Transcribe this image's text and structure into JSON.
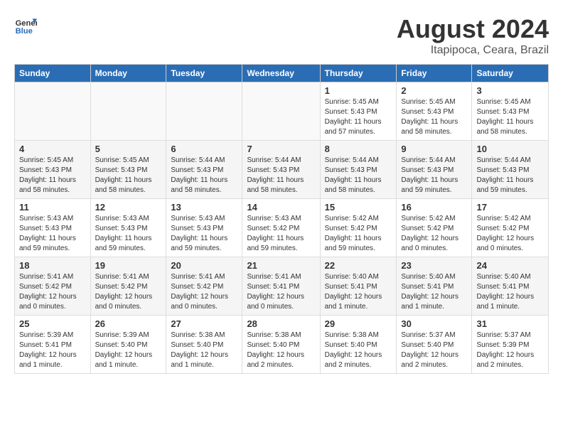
{
  "header": {
    "logo_general": "General",
    "logo_blue": "Blue",
    "title": "August 2024",
    "subtitle": "Itapipoca, Ceara, Brazil"
  },
  "days_of_week": [
    "Sunday",
    "Monday",
    "Tuesday",
    "Wednesday",
    "Thursday",
    "Friday",
    "Saturday"
  ],
  "weeks": [
    [
      {
        "num": "",
        "info": ""
      },
      {
        "num": "",
        "info": ""
      },
      {
        "num": "",
        "info": ""
      },
      {
        "num": "",
        "info": ""
      },
      {
        "num": "1",
        "info": "Sunrise: 5:45 AM\nSunset: 5:43 PM\nDaylight: 11 hours\nand 57 minutes."
      },
      {
        "num": "2",
        "info": "Sunrise: 5:45 AM\nSunset: 5:43 PM\nDaylight: 11 hours\nand 58 minutes."
      },
      {
        "num": "3",
        "info": "Sunrise: 5:45 AM\nSunset: 5:43 PM\nDaylight: 11 hours\nand 58 minutes."
      }
    ],
    [
      {
        "num": "4",
        "info": "Sunrise: 5:45 AM\nSunset: 5:43 PM\nDaylight: 11 hours\nand 58 minutes."
      },
      {
        "num": "5",
        "info": "Sunrise: 5:45 AM\nSunset: 5:43 PM\nDaylight: 11 hours\nand 58 minutes."
      },
      {
        "num": "6",
        "info": "Sunrise: 5:44 AM\nSunset: 5:43 PM\nDaylight: 11 hours\nand 58 minutes."
      },
      {
        "num": "7",
        "info": "Sunrise: 5:44 AM\nSunset: 5:43 PM\nDaylight: 11 hours\nand 58 minutes."
      },
      {
        "num": "8",
        "info": "Sunrise: 5:44 AM\nSunset: 5:43 PM\nDaylight: 11 hours\nand 58 minutes."
      },
      {
        "num": "9",
        "info": "Sunrise: 5:44 AM\nSunset: 5:43 PM\nDaylight: 11 hours\nand 59 minutes."
      },
      {
        "num": "10",
        "info": "Sunrise: 5:44 AM\nSunset: 5:43 PM\nDaylight: 11 hours\nand 59 minutes."
      }
    ],
    [
      {
        "num": "11",
        "info": "Sunrise: 5:43 AM\nSunset: 5:43 PM\nDaylight: 11 hours\nand 59 minutes."
      },
      {
        "num": "12",
        "info": "Sunrise: 5:43 AM\nSunset: 5:43 PM\nDaylight: 11 hours\nand 59 minutes."
      },
      {
        "num": "13",
        "info": "Sunrise: 5:43 AM\nSunset: 5:43 PM\nDaylight: 11 hours\nand 59 minutes."
      },
      {
        "num": "14",
        "info": "Sunrise: 5:43 AM\nSunset: 5:42 PM\nDaylight: 11 hours\nand 59 minutes."
      },
      {
        "num": "15",
        "info": "Sunrise: 5:42 AM\nSunset: 5:42 PM\nDaylight: 11 hours\nand 59 minutes."
      },
      {
        "num": "16",
        "info": "Sunrise: 5:42 AM\nSunset: 5:42 PM\nDaylight: 12 hours\nand 0 minutes."
      },
      {
        "num": "17",
        "info": "Sunrise: 5:42 AM\nSunset: 5:42 PM\nDaylight: 12 hours\nand 0 minutes."
      }
    ],
    [
      {
        "num": "18",
        "info": "Sunrise: 5:41 AM\nSunset: 5:42 PM\nDaylight: 12 hours\nand 0 minutes."
      },
      {
        "num": "19",
        "info": "Sunrise: 5:41 AM\nSunset: 5:42 PM\nDaylight: 12 hours\nand 0 minutes."
      },
      {
        "num": "20",
        "info": "Sunrise: 5:41 AM\nSunset: 5:42 PM\nDaylight: 12 hours\nand 0 minutes."
      },
      {
        "num": "21",
        "info": "Sunrise: 5:41 AM\nSunset: 5:41 PM\nDaylight: 12 hours\nand 0 minutes."
      },
      {
        "num": "22",
        "info": "Sunrise: 5:40 AM\nSunset: 5:41 PM\nDaylight: 12 hours\nand 1 minute."
      },
      {
        "num": "23",
        "info": "Sunrise: 5:40 AM\nSunset: 5:41 PM\nDaylight: 12 hours\nand 1 minute."
      },
      {
        "num": "24",
        "info": "Sunrise: 5:40 AM\nSunset: 5:41 PM\nDaylight: 12 hours\nand 1 minute."
      }
    ],
    [
      {
        "num": "25",
        "info": "Sunrise: 5:39 AM\nSunset: 5:41 PM\nDaylight: 12 hours\nand 1 minute."
      },
      {
        "num": "26",
        "info": "Sunrise: 5:39 AM\nSunset: 5:40 PM\nDaylight: 12 hours\nand 1 minute."
      },
      {
        "num": "27",
        "info": "Sunrise: 5:38 AM\nSunset: 5:40 PM\nDaylight: 12 hours\nand 1 minute."
      },
      {
        "num": "28",
        "info": "Sunrise: 5:38 AM\nSunset: 5:40 PM\nDaylight: 12 hours\nand 2 minutes."
      },
      {
        "num": "29",
        "info": "Sunrise: 5:38 AM\nSunset: 5:40 PM\nDaylight: 12 hours\nand 2 minutes."
      },
      {
        "num": "30",
        "info": "Sunrise: 5:37 AM\nSunset: 5:40 PM\nDaylight: 12 hours\nand 2 minutes."
      },
      {
        "num": "31",
        "info": "Sunrise: 5:37 AM\nSunset: 5:39 PM\nDaylight: 12 hours\nand 2 minutes."
      }
    ]
  ]
}
